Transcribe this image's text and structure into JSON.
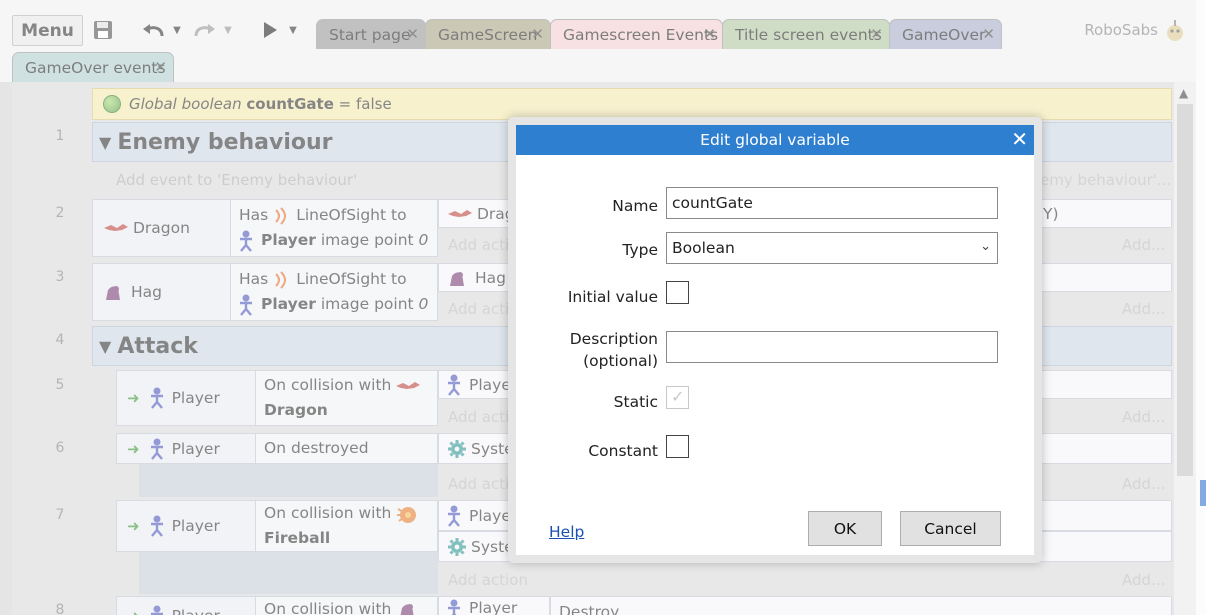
{
  "toolbar": {
    "menu_label": "Menu",
    "tabs": [
      {
        "label": "Start page",
        "color": "#8f8f8f"
      },
      {
        "label": "GameScreen",
        "color": "#a39b7a"
      },
      {
        "label": "Gamescreen Events",
        "color": "#f1c8cc"
      },
      {
        "label": "Title screen events",
        "color": "#a8c29a"
      },
      {
        "label": "GameOver",
        "color": "#9ea4c3"
      },
      {
        "label": "GameOver events",
        "color": "#a9c9c8"
      }
    ],
    "user_name": "RoboSabs"
  },
  "sheet": {
    "global_var": {
      "prefix": "Global boolean",
      "name": "countGate",
      "suffix": "= false"
    },
    "line_numbers": [
      "1",
      "2",
      "3",
      "4",
      "5",
      "6",
      "7",
      "8"
    ],
    "groups": [
      {
        "label": "Enemy behaviour"
      },
      {
        "label": "Attack"
      }
    ],
    "add_event_label": "Add event to 'Enemy behaviour'",
    "add_event_right": "emy behaviour'...",
    "add_action": "Add action",
    "add_action_short": "Add acti",
    "add_right": "Add...",
    "events": [
      {
        "object": "Dragon",
        "cond_prefix": "Has",
        "cond_a": "LineOfSight to",
        "cond_b_obj": "Player",
        "cond_b": "image point",
        "cond_b_val": "0",
        "action_obj": "Drag"
      },
      {
        "object": "Hag",
        "cond_prefix": "Has",
        "cond_a": "LineOfSight to",
        "cond_b_obj": "Player",
        "cond_b": "image point",
        "cond_b_val": "0",
        "action_obj": "Hag"
      },
      {
        "object": "Player",
        "cond_a": "On collision with",
        "cond_b_obj": "Dragon",
        "action_obj": "Playe"
      },
      {
        "object": "Player",
        "cond_a": "On destroyed",
        "action_obj": "Syste"
      },
      {
        "object": "Player",
        "cond_a": "On collision with",
        "cond_b_obj": "Fireball",
        "action_obj": "Playe",
        "action_obj2": "Syste"
      },
      {
        "object": "Player",
        "cond_a": "On collision with",
        "action_obj": "Player",
        "action_text": "Destroy"
      }
    ],
    "right_fragment": "Y)"
  },
  "dialog": {
    "title": "Edit global variable",
    "name_label": "Name",
    "name_value": "countGate",
    "type_label": "Type",
    "type_value": "Boolean",
    "initial_label": "Initial value",
    "desc_label_1": "Description",
    "desc_label_2": "(optional)",
    "desc_value": "",
    "static_label": "Static",
    "constant_label": "Constant",
    "help_label": "Help",
    "ok_label": "OK",
    "cancel_label": "Cancel"
  },
  "colors": {
    "accent": "#2f7fd1",
    "group_bg": "#c7d1e1",
    "global_bg": "#f1e6a7"
  }
}
